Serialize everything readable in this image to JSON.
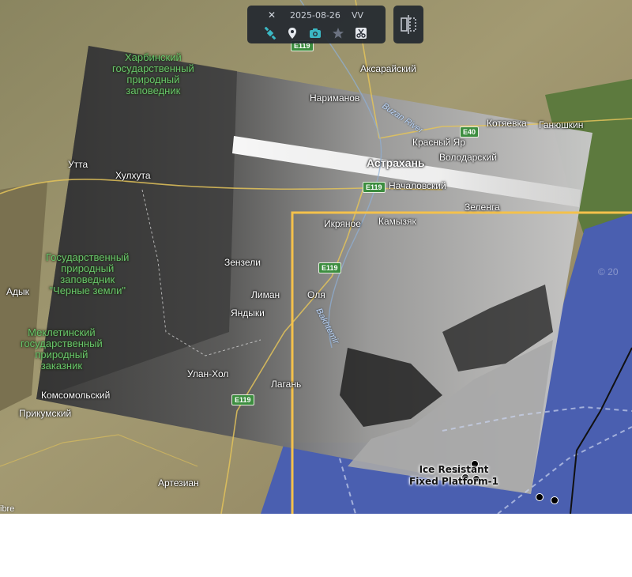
{
  "toolbar": {
    "date": "2025-08-26",
    "polarization": "VV",
    "icons": [
      "satellite-icon",
      "layers-pin-icon",
      "camera-icon",
      "star-icon",
      "scissors-icon"
    ],
    "accent": "#3bb8c4",
    "compare_icon": "split-compare-icon"
  },
  "overlay": {
    "selection_color": "#f4c14b",
    "sea_color": "#4a5fb0"
  },
  "map": {
    "attribution": "ibre",
    "watermark": "© 20",
    "cities": {
      "astrakhan": "Астрахань",
      "narimanov": "Нариманов",
      "aksaraysky": "Аксарайский",
      "kotyaevka": "Котяевка",
      "ganyushkin": "Ганюшкин",
      "krasny_yar": "Красный Яр",
      "volodarsky": "Володарский",
      "nachalovsky": "Началовский",
      "zelenga": "Зеленга",
      "utta": "Утта",
      "khulkhuta": "Хулхута",
      "ikryanoe": "Икряное",
      "kamyzyak": "Камызяк",
      "zenzeli": "Зензели",
      "liman": "Лиман",
      "olya": "Оля",
      "yandyki": "Яндыки",
      "adyk": "Адык",
      "ulan_khol": "Улан-Хол",
      "lagan": "Лагань",
      "komsomolsky": "Комсомольский",
      "prikumsky": "Прикумский",
      "artezian": "Артезиан"
    },
    "reserves": {
      "kharbinsky": "Харбинский\nгосударственный\nприродный\nзаповедник",
      "black_lands": "Государственный\nприродный\nзаповедник\n\"Черные земли\"",
      "mekletinsky": "Меклетинский\nгосударственный\nприродный\nзаказник"
    },
    "rivers": {
      "buzan": "Buzan River",
      "bakhtemir": "Bakhtemir"
    },
    "roads": {
      "e119_north": "E119",
      "e40": "E40",
      "e119_center": "E119",
      "e119_mid": "E119",
      "e119_south": "E119"
    },
    "platform_label": "Ice Resistant\nFixed Platform-1"
  }
}
